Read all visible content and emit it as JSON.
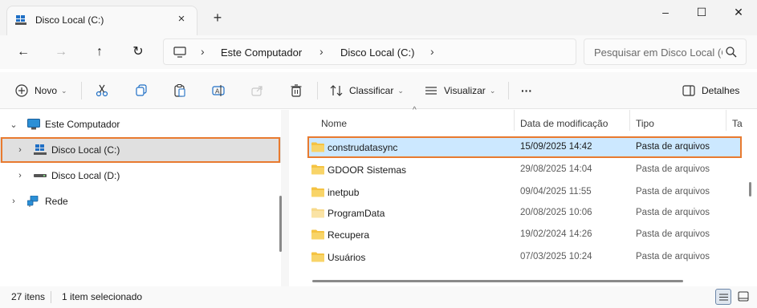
{
  "window": {
    "tab_title": "Disco Local (C:)",
    "tab_close": "×",
    "new_tab": "+",
    "minimize": "–",
    "maximize": "☐",
    "close": "✕"
  },
  "address": {
    "back": "←",
    "forward": "→",
    "up": "↑",
    "refresh": "↻",
    "crumbs": [
      "Este Computador",
      "Disco Local (C:)"
    ],
    "separator": "›",
    "search_placeholder": "Pesquisar em Disco Local (C:)"
  },
  "toolbar": {
    "new_label": "Novo",
    "sort_label": "Classificar",
    "view_label": "Visualizar",
    "more_label": "···",
    "details_label": "Detalhes",
    "chevron": "⌄"
  },
  "nav": {
    "items": [
      {
        "label": "Este Computador",
        "expander": "⌄",
        "icon": "monitor-icon"
      },
      {
        "label": "Disco Local (C:)",
        "expander": "›",
        "icon": "windows-drive-icon",
        "selected": true
      },
      {
        "label": "Disco Local (D:)",
        "expander": "›",
        "icon": "drive-icon"
      },
      {
        "label": "Rede",
        "expander": "›",
        "icon": "network-icon"
      }
    ]
  },
  "list": {
    "columns": [
      "Nome",
      "Data de modificação",
      "Tipo",
      "Ta"
    ],
    "sort_caret": "^",
    "rows": [
      {
        "name": "construdatasync",
        "date": "15/09/2025 14:42",
        "type": "Pasta de arquivos",
        "selected": true
      },
      {
        "name": "GDOOR Sistemas",
        "date": "29/08/2025 14:04",
        "type": "Pasta de arquivos"
      },
      {
        "name": "inetpub",
        "date": "09/04/2025 11:55",
        "type": "Pasta de arquivos"
      },
      {
        "name": "ProgramData",
        "date": "20/08/2025 10:06",
        "type": "Pasta de arquivos"
      },
      {
        "name": "Recupera",
        "date": "19/02/2024 14:26",
        "type": "Pasta de arquivos"
      },
      {
        "name": "Usuários",
        "date": "07/03/2025 10:24",
        "type": "Pasta de arquivos"
      }
    ]
  },
  "status": {
    "count": "27 itens",
    "selection": "1 item selecionado"
  },
  "colors": {
    "accent_outline": "#e87a2f",
    "selection_bg": "#cce8ff",
    "folder_yellow": "#f5c342"
  }
}
